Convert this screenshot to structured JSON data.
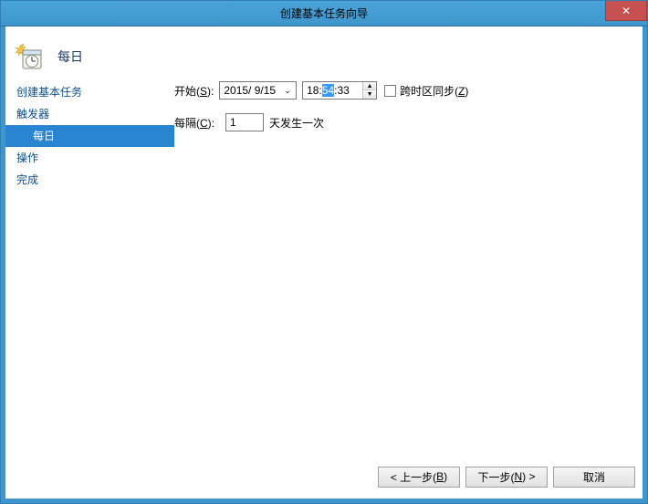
{
  "window": {
    "title": "创建基本任务向导"
  },
  "header": {
    "title": "每日"
  },
  "sidebar": {
    "items": [
      {
        "label": "创建基本任务"
      },
      {
        "label": "触发器"
      },
      {
        "label": "每日"
      },
      {
        "label": "操作"
      },
      {
        "label": "完成"
      }
    ]
  },
  "form": {
    "start_label_prefix": "开始(",
    "start_label_key": "S",
    "start_label_suffix": "):",
    "date_value": "2015/ 9/15",
    "time_h": "18:",
    "time_m_sel": "54",
    "time_s": ":33",
    "tz_label_prefix": "跨时区同步(",
    "tz_label_key": "Z",
    "tz_label_suffix": ")",
    "interval_label_prefix": "每隔(",
    "interval_label_key": "C",
    "interval_label_suffix": "):",
    "interval_value": "1",
    "interval_unit": "天发生一次"
  },
  "buttons": {
    "back_prefix": "< 上一步(",
    "back_key": "B",
    "back_suffix": ")",
    "next_prefix": "下一步(",
    "next_key": "N",
    "next_suffix": ") >",
    "cancel": "取消"
  }
}
